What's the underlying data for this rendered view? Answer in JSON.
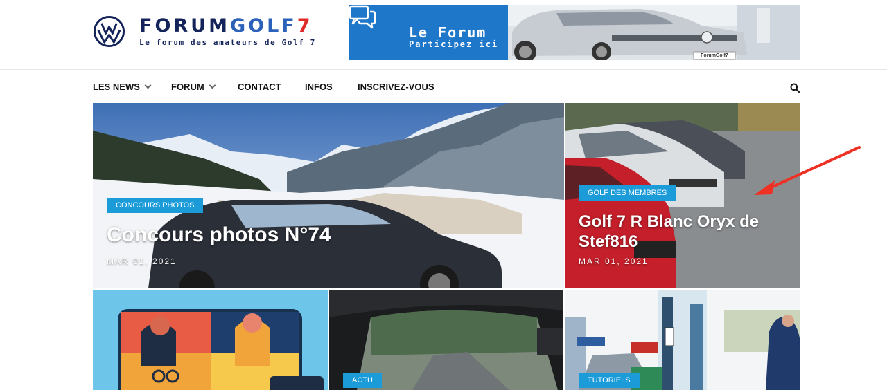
{
  "logo": {
    "title_part1": "FORUM",
    "title_part2": "GOLF",
    "title_part3": "7",
    "tagline": "Le forum des amateurs de Golf 7",
    "icon": "vw-logo-icon"
  },
  "banner": {
    "title": "Le Forum",
    "subtitle": "Participez ici",
    "plate": "ForumGolf7",
    "icon": "chat-icon"
  },
  "nav": {
    "items": [
      {
        "label": "LES NEWS",
        "has_dropdown": true
      },
      {
        "label": "FORUM",
        "has_dropdown": true
      },
      {
        "label": "CONTACT",
        "has_dropdown": false
      },
      {
        "label": "INFOS",
        "has_dropdown": false
      },
      {
        "label": "INSCRIVEZ-VOUS",
        "has_dropdown": false
      }
    ],
    "search_icon": "search-icon"
  },
  "featured": [
    {
      "category": "CONCOURS PHOTOS",
      "title": "Concours photos N°74",
      "date": "MAR 01, 2021"
    },
    {
      "category": "GOLF DES MEMBRES",
      "title_line1": "Golf 7 R Blanc Oryx de",
      "title_line2": "Stef816",
      "date": "MAR 01, 2021"
    }
  ],
  "tiles": [
    {
      "category": ""
    },
    {
      "category": "ACTU"
    },
    {
      "category": "TUTORIELS"
    }
  ],
  "colors": {
    "badge": "#1c9bd9",
    "navy": "#14245a",
    "blue": "#2b61b8",
    "red": "#e02a2a",
    "annotation_arrow": "#ee3124"
  }
}
